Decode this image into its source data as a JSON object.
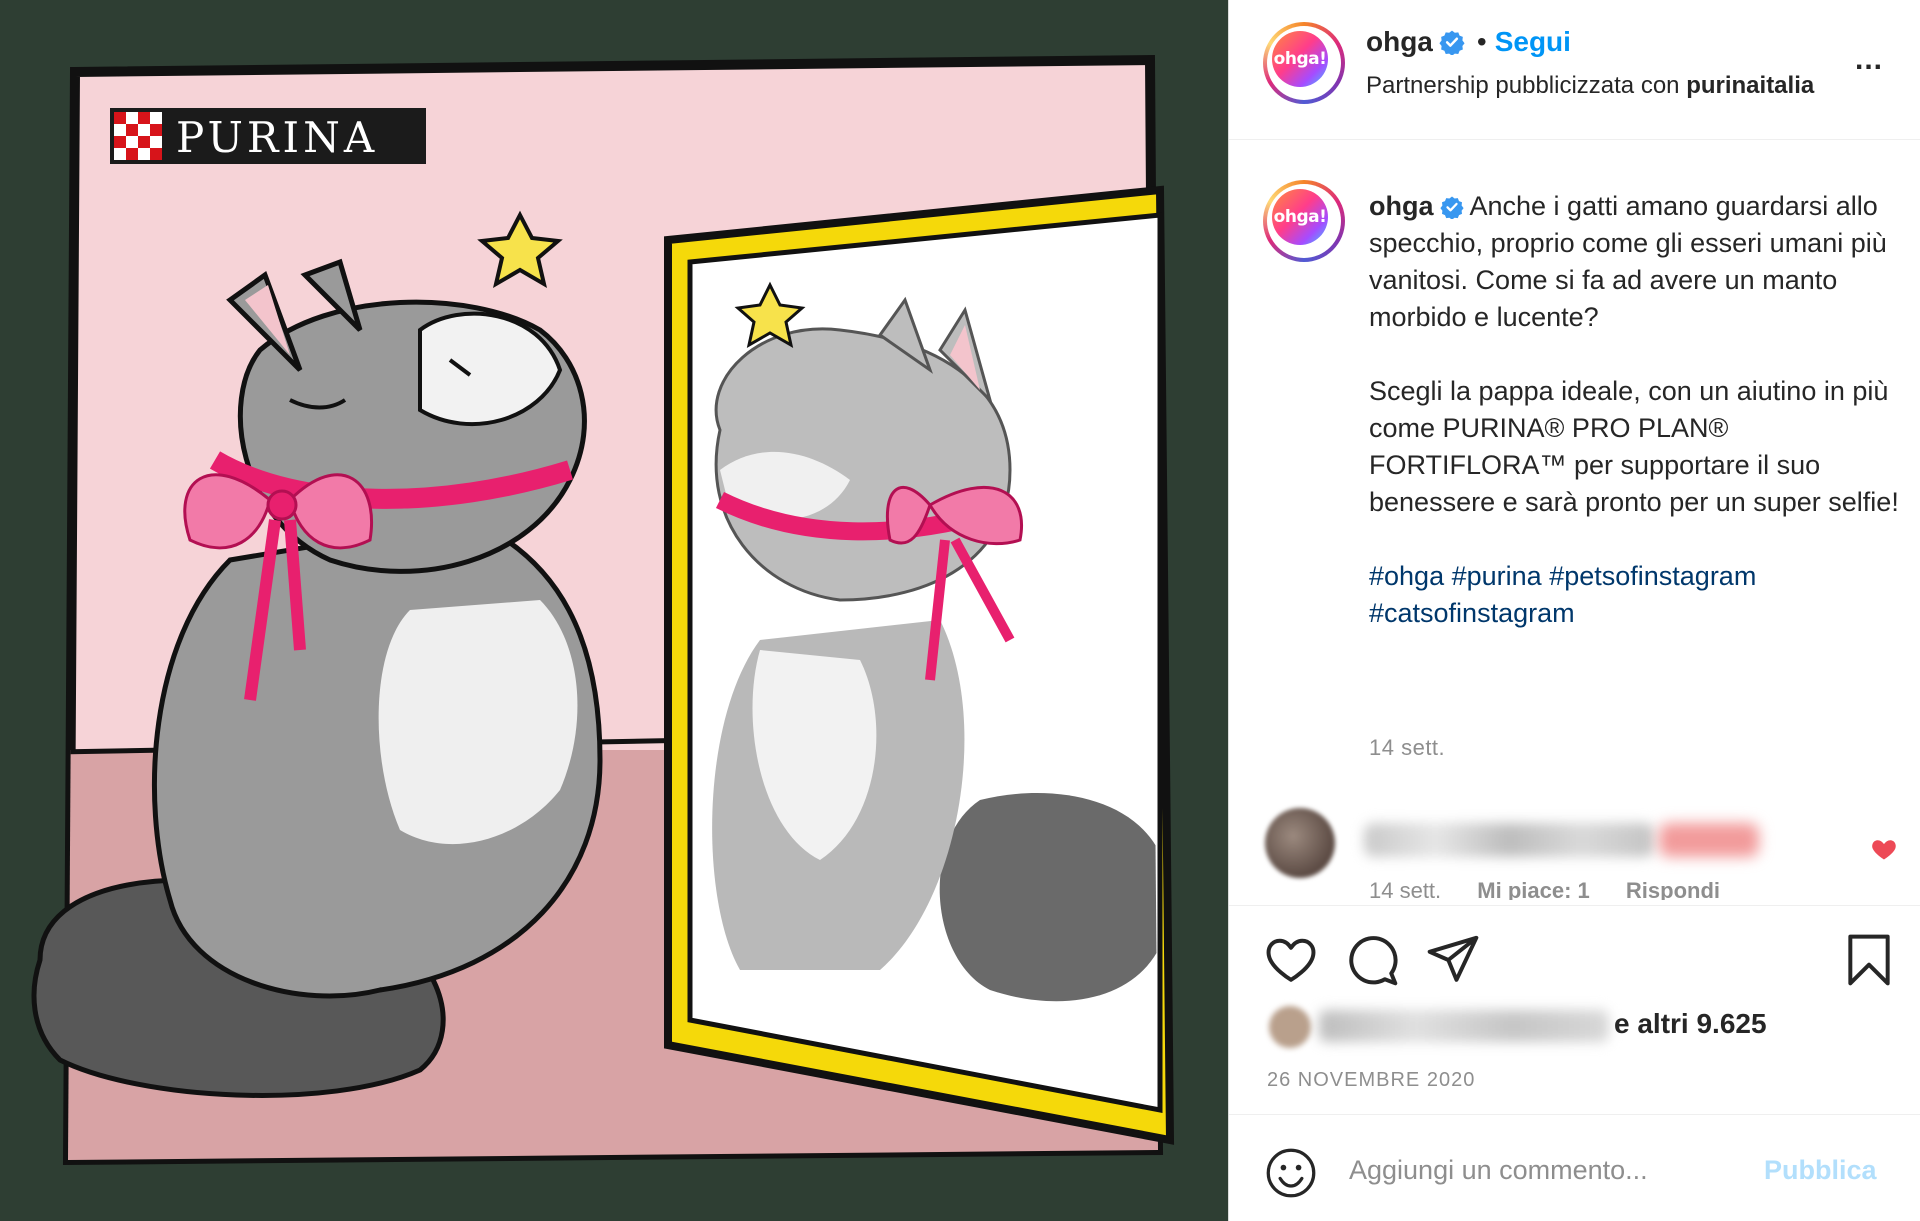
{
  "post": {
    "brand_logo_text": "PURINA",
    "account": {
      "username": "ohga",
      "avatar_text": "ohga!",
      "follow_label": "Segui",
      "separator": "•",
      "partnership_prefix": "Partnership pubblicizzata con",
      "partner": "purinaitalia",
      "more_label": "..."
    },
    "caption": {
      "username": "ohga",
      "paragraph1": "Anche i gatti amano guardarsi allo specchio, proprio come gli esseri umani più vanitosi. Come si fa ad avere un manto morbido e lucente?",
      "paragraph2": "Scegli la pappa ideale, con un aiutino in più come PURINA® PRO PLAN® FORTIFLORA™ per supportare il suo benessere e sarà pronto per un super selfie!",
      "hashtags": [
        "#ohga",
        "#purina",
        "#petsofinstagram",
        "#catsofinstagram"
      ],
      "time": "14 sett."
    },
    "comment": {
      "time": "14 sett.",
      "likes": "Mi piace: 1",
      "reply": "Rispondi"
    },
    "likes_text": "e altri 9.625",
    "date": "26 NOVEMBRE 2020",
    "add_comment": {
      "placeholder": "Aggiungi un commento...",
      "publish_label": "Pubblica"
    }
  },
  "colors": {
    "accent": "#0095f6",
    "hashtag": "#00376b",
    "muted": "#8e8e8e",
    "like_red": "#ed4956",
    "publish_disabled": "#b2dffc",
    "image_background": "#2e3e33",
    "wall_pink": "#f6d3d7",
    "mirror_frame": "#f5d90a",
    "bow": "#e8206e"
  }
}
